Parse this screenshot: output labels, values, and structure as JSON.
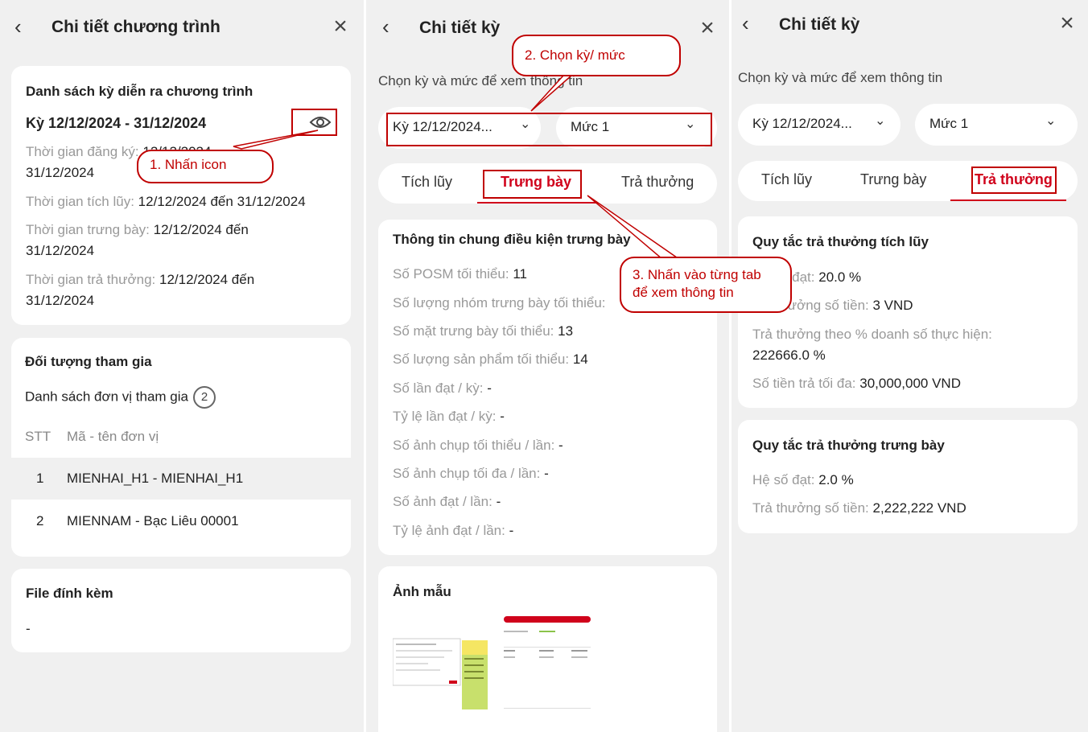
{
  "panel1": {
    "title": "Chi tiết chương trình",
    "card1": {
      "title": "Danh sách kỳ diễn ra chương trình",
      "period": "Kỳ 12/12/2024 - 31/12/2024",
      "reg_label": "Thời gian đăng ký:",
      "reg_value": "12/12/2024",
      "reg_value2": "31/12/2024",
      "acc_label": "Thời gian tích lũy:",
      "acc_value": "12/12/2024 đến 31/12/2024",
      "disp_label": "Thời gian trưng bày:",
      "disp_value": "12/12/2024 đến",
      "disp_value2": "31/12/2024",
      "rew_label": "Thời gian trả thưởng:",
      "rew_value": "12/12/2024 đến",
      "rew_value2": "31/12/2024"
    },
    "card2": {
      "title": "Đối tượng tham gia",
      "list_label": "Danh sách đơn vị tham gia",
      "list_count": "2",
      "col_stt": "STT",
      "col_name": "Mã - tên đơn vị",
      "rows": [
        {
          "n": "1",
          "t": "MIENHAI_H1 - MIENHAI_H1"
        },
        {
          "n": "2",
          "t": "MIENNAM - Bạc Liêu 00001"
        }
      ]
    },
    "card3": {
      "title": "File đính kèm",
      "value": "-"
    },
    "callout": "1. Nhấn icon"
  },
  "panel2": {
    "title": "Chi tiết kỳ",
    "subtitle": "Chọn kỳ và mức để xem thông tin",
    "period_select": "Kỳ 12/12/2024...",
    "level_select": "Mức 1",
    "tabs": [
      "Tích lũy",
      "Trưng bày",
      "Trả thưởng"
    ],
    "info": {
      "title": "Thông tin chung điều kiện trưng bày",
      "items": [
        {
          "label": "Số POSM tối thiểu:",
          "value": "11"
        },
        {
          "label": "Số lượng nhóm trưng bày tối thiểu:",
          "value": ""
        },
        {
          "label": "Số mặt trưng bày tối thiểu:",
          "value": "13"
        },
        {
          "label": "Số lượng sản phẩm tối thiểu:",
          "value": "14"
        },
        {
          "label": "Số lần đạt / kỳ:",
          "value": "-"
        },
        {
          "label": "Tỷ lệ lần đạt / kỳ:",
          "value": "-"
        },
        {
          "label": "Số ảnh chụp tối thiểu / lần:",
          "value": "-"
        },
        {
          "label": "Số ảnh chụp tối đa / lần:",
          "value": "-"
        },
        {
          "label": "Số ảnh đạt / lần:",
          "value": "-"
        },
        {
          "label": "Tỷ lệ ảnh đạt / lần:",
          "value": "-"
        }
      ]
    },
    "sample": {
      "title": "Ảnh mẫu"
    },
    "callout2": "2. Chọn kỳ/ mức",
    "callout3_line1": "3. Nhấn vào từng tab",
    "callout3_line2": "để xem thông tin"
  },
  "panel3": {
    "title": "Chi tiết kỳ",
    "subtitle": "Chọn kỳ và mức để xem thông tin",
    "period_select": "Kỳ 12/12/2024...",
    "level_select": "Mức 1",
    "tabs": [
      "Tích lũy",
      "Trưng bày",
      "Trả thưởng"
    ],
    "card1": {
      "title": "Quy tắc trả thưởng tích lũy",
      "l1_label": "Hệ số đạt:",
      "l1_value": "20.0 %",
      "l2_label": "Trả thưởng số tiền:",
      "l2_value": "3 VND",
      "l3_label": "Trả thưởng theo % doanh số thực hiện:",
      "l3_value": "222666.0 %",
      "l4_label": "Số tiền trả tối đa:",
      "l4_value": "30,000,000 VND"
    },
    "card2": {
      "title": "Quy tắc trả thưởng trưng bày",
      "l1_label": "Hệ số đạt:",
      "l1_value": "2.0 %",
      "l2_label": "Trả thưởng số tiền:",
      "l2_value": "2,222,222 VND"
    }
  },
  "colors": {
    "accent": "#d0021b",
    "annotation": "#c00000",
    "background": "#f0f0f0",
    "card": "#ffffff"
  },
  "icons": [
    "chevron-left-icon",
    "close-icon",
    "eye-icon",
    "chevron-down-icon"
  ]
}
